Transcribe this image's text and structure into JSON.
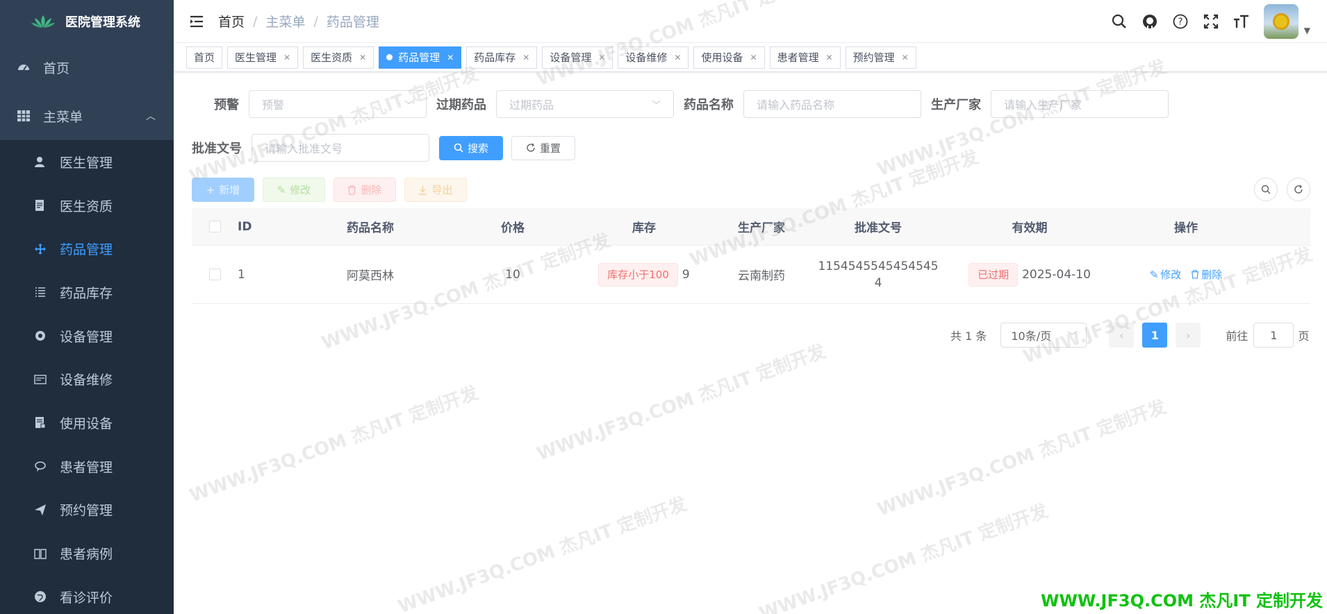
{
  "app": {
    "title": "医院管理系统"
  },
  "sidebar": {
    "items": [
      {
        "label": "首页",
        "icon": "dashboard-icon"
      },
      {
        "label": "主菜单",
        "icon": "grid-icon"
      }
    ],
    "submenu": [
      {
        "label": "医生管理",
        "icon": "user-icon"
      },
      {
        "label": "医生资质",
        "icon": "document-icon"
      },
      {
        "label": "药品管理",
        "icon": "move-icon"
      },
      {
        "label": "药品库存",
        "icon": "list-icon"
      },
      {
        "label": "设备管理",
        "icon": "settings-icon"
      },
      {
        "label": "设备维修",
        "icon": "card-icon"
      },
      {
        "label": "使用设备",
        "icon": "report-icon"
      },
      {
        "label": "患者管理",
        "icon": "chat-icon"
      },
      {
        "label": "预约管理",
        "icon": "send-icon"
      },
      {
        "label": "患者病例",
        "icon": "book-icon"
      },
      {
        "label": "看诊评价",
        "icon": "globe-icon"
      }
    ]
  },
  "header": {
    "breadcrumb": [
      "首页",
      "主菜单",
      "药品管理"
    ]
  },
  "tags": [
    {
      "label": "首页",
      "closable": false,
      "active": false
    },
    {
      "label": "医生管理",
      "closable": true,
      "active": false
    },
    {
      "label": "医生资质",
      "closable": true,
      "active": false
    },
    {
      "label": "药品管理",
      "closable": true,
      "active": true
    },
    {
      "label": "药品库存",
      "closable": true,
      "active": false
    },
    {
      "label": "设备管理",
      "closable": true,
      "active": false
    },
    {
      "label": "设备维修",
      "closable": true,
      "active": false
    },
    {
      "label": "使用设备",
      "closable": true,
      "active": false
    },
    {
      "label": "患者管理",
      "closable": true,
      "active": false
    },
    {
      "label": "预约管理",
      "closable": true,
      "active": false
    }
  ],
  "search": {
    "warning_label": "预警",
    "warning_placeholder": "预警",
    "expired_label": "过期药品",
    "expired_placeholder": "过期药品",
    "name_label": "药品名称",
    "name_placeholder": "请输入药品名称",
    "maker_label": "生产厂家",
    "maker_placeholder": "请输入生产厂家",
    "approval_label": "批准文号",
    "approval_placeholder": "请输入批准文号",
    "search_button": "搜索",
    "reset_button": "重置"
  },
  "toolbar": {
    "add": "新增",
    "edit": "修改",
    "delete": "删除",
    "export": "导出"
  },
  "table": {
    "headers": [
      "ID",
      "药品名称",
      "价格",
      "库存",
      "生产厂家",
      "批准文号",
      "有效期",
      "操作"
    ],
    "rows": [
      {
        "id": "1",
        "name": "阿莫西林",
        "price": "10",
        "stock_badge": "库存小于100",
        "stock": "9",
        "maker": "云南制药",
        "approval_line1": "1154545545454545",
        "approval_line2": "4",
        "expiry_badge": "已过期",
        "expiry": "2025-04-10",
        "op_edit": "修改",
        "op_delete": "删除"
      }
    ]
  },
  "pagination": {
    "total": "共 1 条",
    "page_size": "10条/页",
    "current": "1",
    "goto_label": "前往",
    "goto_value": "1",
    "page_suffix": "页"
  },
  "watermark": {
    "text": "WWW.JF3Q.COM 杰凡IT 定制开发",
    "color": "#11c211"
  },
  "colors": {
    "sidebar_bg": "#304156",
    "submenu_bg": "#1f2d3d",
    "primary": "#409eff",
    "danger": "#f56c6c"
  }
}
